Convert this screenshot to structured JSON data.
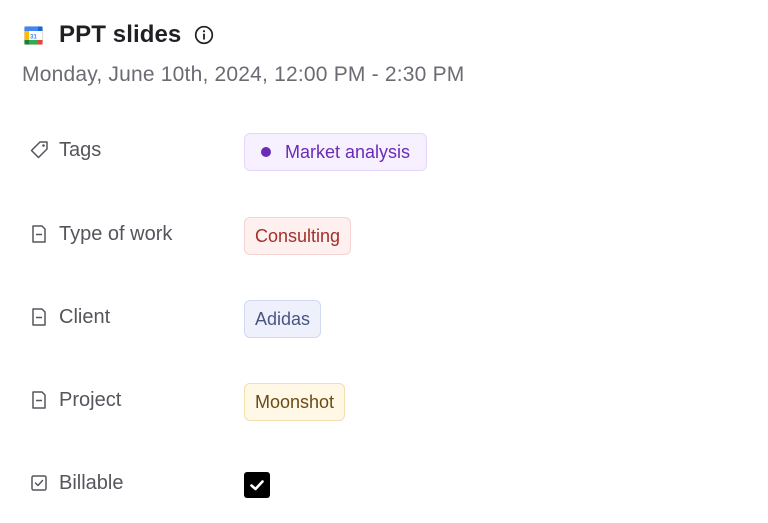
{
  "event": {
    "title": "PPT slides",
    "datetime": "Monday, June 10th, 2024, 12:00 PM - 2:30 PM",
    "calendar_icon_day": "31"
  },
  "properties": [
    {
      "label": "Tags",
      "icon": "tag-icon",
      "value": "Market analysis",
      "style": "tag",
      "color": "#6a2bb6"
    },
    {
      "label": "Type of work",
      "icon": "select-field-icon",
      "value": "Consulting",
      "style": "red",
      "color": "#a3302a"
    },
    {
      "label": "Client",
      "icon": "select-field-icon",
      "value": "Adidas",
      "style": "blue",
      "color": "#4a5582"
    },
    {
      "label": "Project",
      "icon": "select-field-icon",
      "value": "Moonshot",
      "style": "yellow",
      "color": "#6b4a14"
    },
    {
      "label": "Billable",
      "icon": "checkbox-field-icon",
      "checked": true
    }
  ]
}
